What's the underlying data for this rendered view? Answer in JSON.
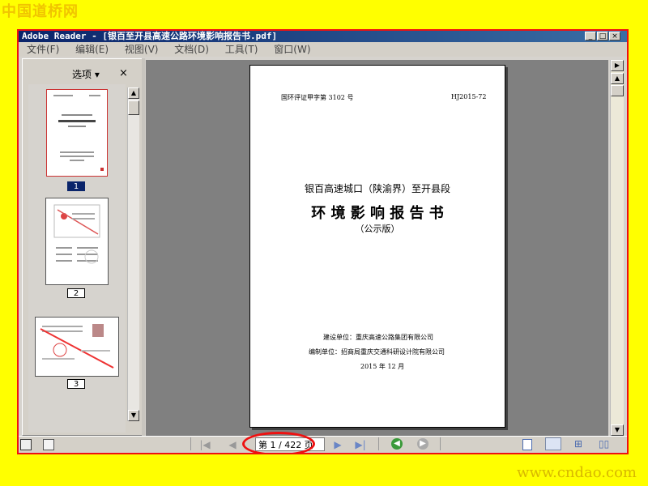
{
  "watermark": {
    "top": "中国道桥网",
    "bottom": "www.cndao.com"
  },
  "window": {
    "title": "Adobe Reader - [银百至开县高速公路环境影响报告书.pdf]",
    "buttons": [
      "_",
      "□",
      "×"
    ]
  },
  "menu": [
    "文件(F)",
    "编辑(E)",
    "视图(V)",
    "文档(D)",
    "工具(T)",
    "窗口(W)"
  ],
  "left_panel": {
    "options_label": "选项 ▾",
    "close_label": "×",
    "thumbnails": [
      {
        "label": "1",
        "selected": true
      },
      {
        "label": "2",
        "selected": false
      },
      {
        "label": "3",
        "selected": false
      }
    ]
  },
  "document": {
    "doc_no": "国环评证甲字第 3102 号",
    "code": "HJ2015-72",
    "project": "银百高速城口（陕渝界）至开县段",
    "report_title": "环 境 影 响 报 告 书",
    "edition": "（公示版）",
    "builder": "建设单位：重庆高速公路集团有限公司",
    "compiler": "编制单位：招商局重庆交通科研设计院有限公司",
    "date": "2015 年 12 月"
  },
  "navigation": {
    "page_indicator": "第 1 / 422 页"
  },
  "colors": {
    "highlight_circle": "#ee1111",
    "frame": "#ee1111",
    "background": "#ffff00"
  }
}
